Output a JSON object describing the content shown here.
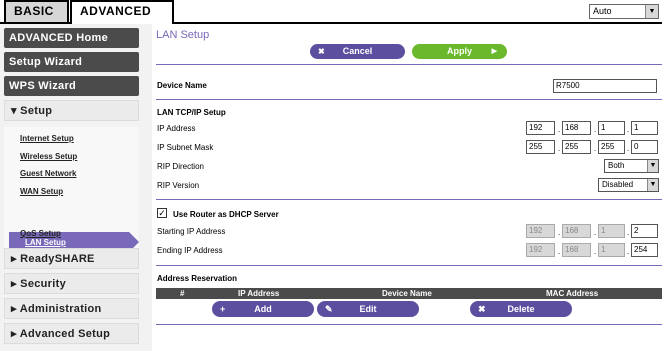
{
  "tabs": {
    "basic": "BASIC",
    "advanced": "ADVANCED"
  },
  "language": {
    "selected": "Auto"
  },
  "sidebar": {
    "advanced_home": "ADVANCED Home",
    "setup_wizard": "Setup Wizard",
    "wps_wizard": "WPS Wizard",
    "setup": "▾ Setup",
    "setup_items": [
      "Internet Setup",
      "Wireless Setup",
      "Guest Network",
      "WAN Setup",
      "LAN Setup",
      "QoS Setup"
    ],
    "readyshare": "▸ ReadySHARE",
    "security": "▸ Security",
    "administration": "▸ Administration",
    "advanced_setup": "▸ Advanced Setup"
  },
  "main": {
    "title": "LAN Setup",
    "cancel": "Cancel",
    "apply": "Apply",
    "device_name_label": "Device Name",
    "device_name_value": "R7500",
    "lan_tcpip_heading": "LAN TCP/IP Setup",
    "ip_address_label": "IP Address",
    "ip_address": [
      "192",
      "168",
      "1",
      "1"
    ],
    "subnet_label": "IP Subnet Mask",
    "subnet": [
      "255",
      "255",
      "255",
      "0"
    ],
    "rip_direction_label": "RIP Direction",
    "rip_direction_value": "Both",
    "rip_version_label": "RIP Version",
    "rip_version_value": "Disabled",
    "dhcp_label": "Use Router as DHCP Server",
    "dhcp_checked": "✓",
    "start_ip_label": "Starting IP Address",
    "start_ip": [
      "192",
      "168",
      "1",
      "2"
    ],
    "end_ip_label": "Ending IP Address",
    "end_ip": [
      "192",
      "168",
      "1",
      "254"
    ],
    "reservation_heading": "Address Reservation",
    "table_headers": [
      "#",
      "IP Address",
      "Device Name",
      "MAC Address"
    ],
    "add": "Add",
    "edit": "Edit",
    "delete": "Delete"
  },
  "colors": {
    "accent": "#7a68b8",
    "button": "#5d4fa0",
    "apply": "#6ab82c",
    "nav_dark": "#4b4b4b"
  }
}
